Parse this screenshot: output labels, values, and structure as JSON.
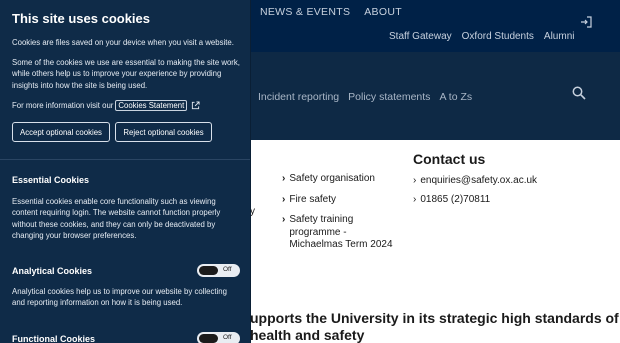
{
  "site": {
    "top_nav": [
      "NEWS & EVENTS",
      "ABOUT"
    ],
    "secondary_nav": [
      "Staff Gateway",
      "Oxford Students",
      "Alumni"
    ],
    "main_nav": [
      "Incident reporting",
      "Policy statements",
      "A to Zs"
    ],
    "stray_text": "y",
    "links": [
      "Safety organisation",
      "Fire safety",
      "Safety training programme - Michaelmas Term 2024"
    ],
    "contact": {
      "title": "Contact us",
      "email": "enquiries@safety.ox.ac.uk",
      "phone": "01865 (2)70811"
    },
    "mission_text": "upports the University in its strategic high standards of health and safety"
  },
  "cookie_panel": {
    "title": "This site uses cookies",
    "intro": "Cookies are files saved on your device when you visit a website.",
    "essential_note": "Some of the cookies we use are essential to making the site work, while others help us to improve your experience by providing insights into how the site is being used.",
    "more_info_prefix": "For more information visit our",
    "statement_link": "Cookies Statement",
    "accept_button": "Accept optional cookies",
    "reject_button": "Reject optional cookies",
    "essential_title": "Essential Cookies",
    "essential_desc": "Essential cookies enable core functionality such as viewing content requiring login. The website cannot function properly without these cookies, and they can only be deactivated by changing your browser preferences.",
    "analytical_title": "Analytical Cookies",
    "analytical_toggle": "Off",
    "analytical_desc": "Analytical cookies help us to improve our website by collecting and reporting information on how it is being used.",
    "functional_title": "Functional Cookies",
    "functional_toggle": "Off"
  },
  "colors": {
    "header_bg": "#002147",
    "panel_bg": "#0f2b48",
    "text_light": "#ffffff"
  }
}
